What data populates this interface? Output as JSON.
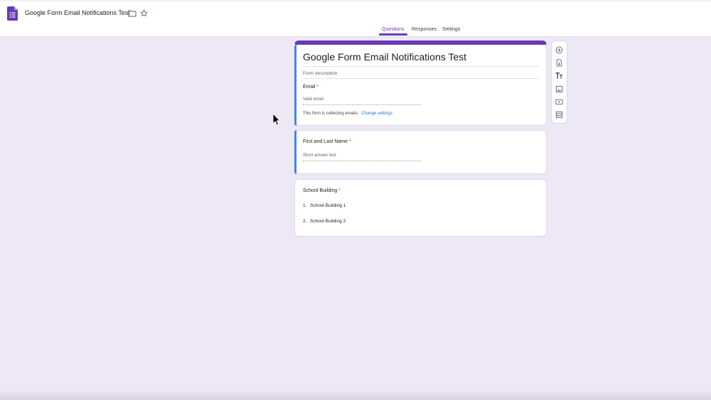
{
  "app": {
    "doc_title": "Google Form Email Notifications Test"
  },
  "header": {
    "tabs": [
      {
        "label": "Questions",
        "active": true
      },
      {
        "label": "Responses",
        "active": false
      },
      {
        "label": "Settings",
        "active": false
      }
    ]
  },
  "form": {
    "title": "Google Form Email Notifications Test",
    "description_placeholder": "Form description",
    "email_question": {
      "label": "Email",
      "required_mark": "*",
      "placeholder": "Valid email",
      "note": "This form is collecting emails.",
      "note_link": "Change settings"
    }
  },
  "questions": [
    {
      "label": "First and Last Name",
      "required_mark": "*",
      "placeholder": "Short answer text"
    },
    {
      "label": "School Building",
      "required_mark": "*",
      "options": [
        {
          "num": "1.",
          "text": "School Building 1"
        },
        {
          "num": "2.",
          "text": "School Building 2"
        }
      ]
    }
  ],
  "toolbar": {
    "items": [
      "add-question-icon",
      "import-questions-icon",
      "add-title-icon",
      "add-image-icon",
      "add-video-icon",
      "add-section-icon"
    ]
  },
  "colors": {
    "accent": "#673ab7",
    "focus": "#4285f4",
    "background": "#ede7f6",
    "link": "#1a73e8",
    "required": "#d93025"
  }
}
